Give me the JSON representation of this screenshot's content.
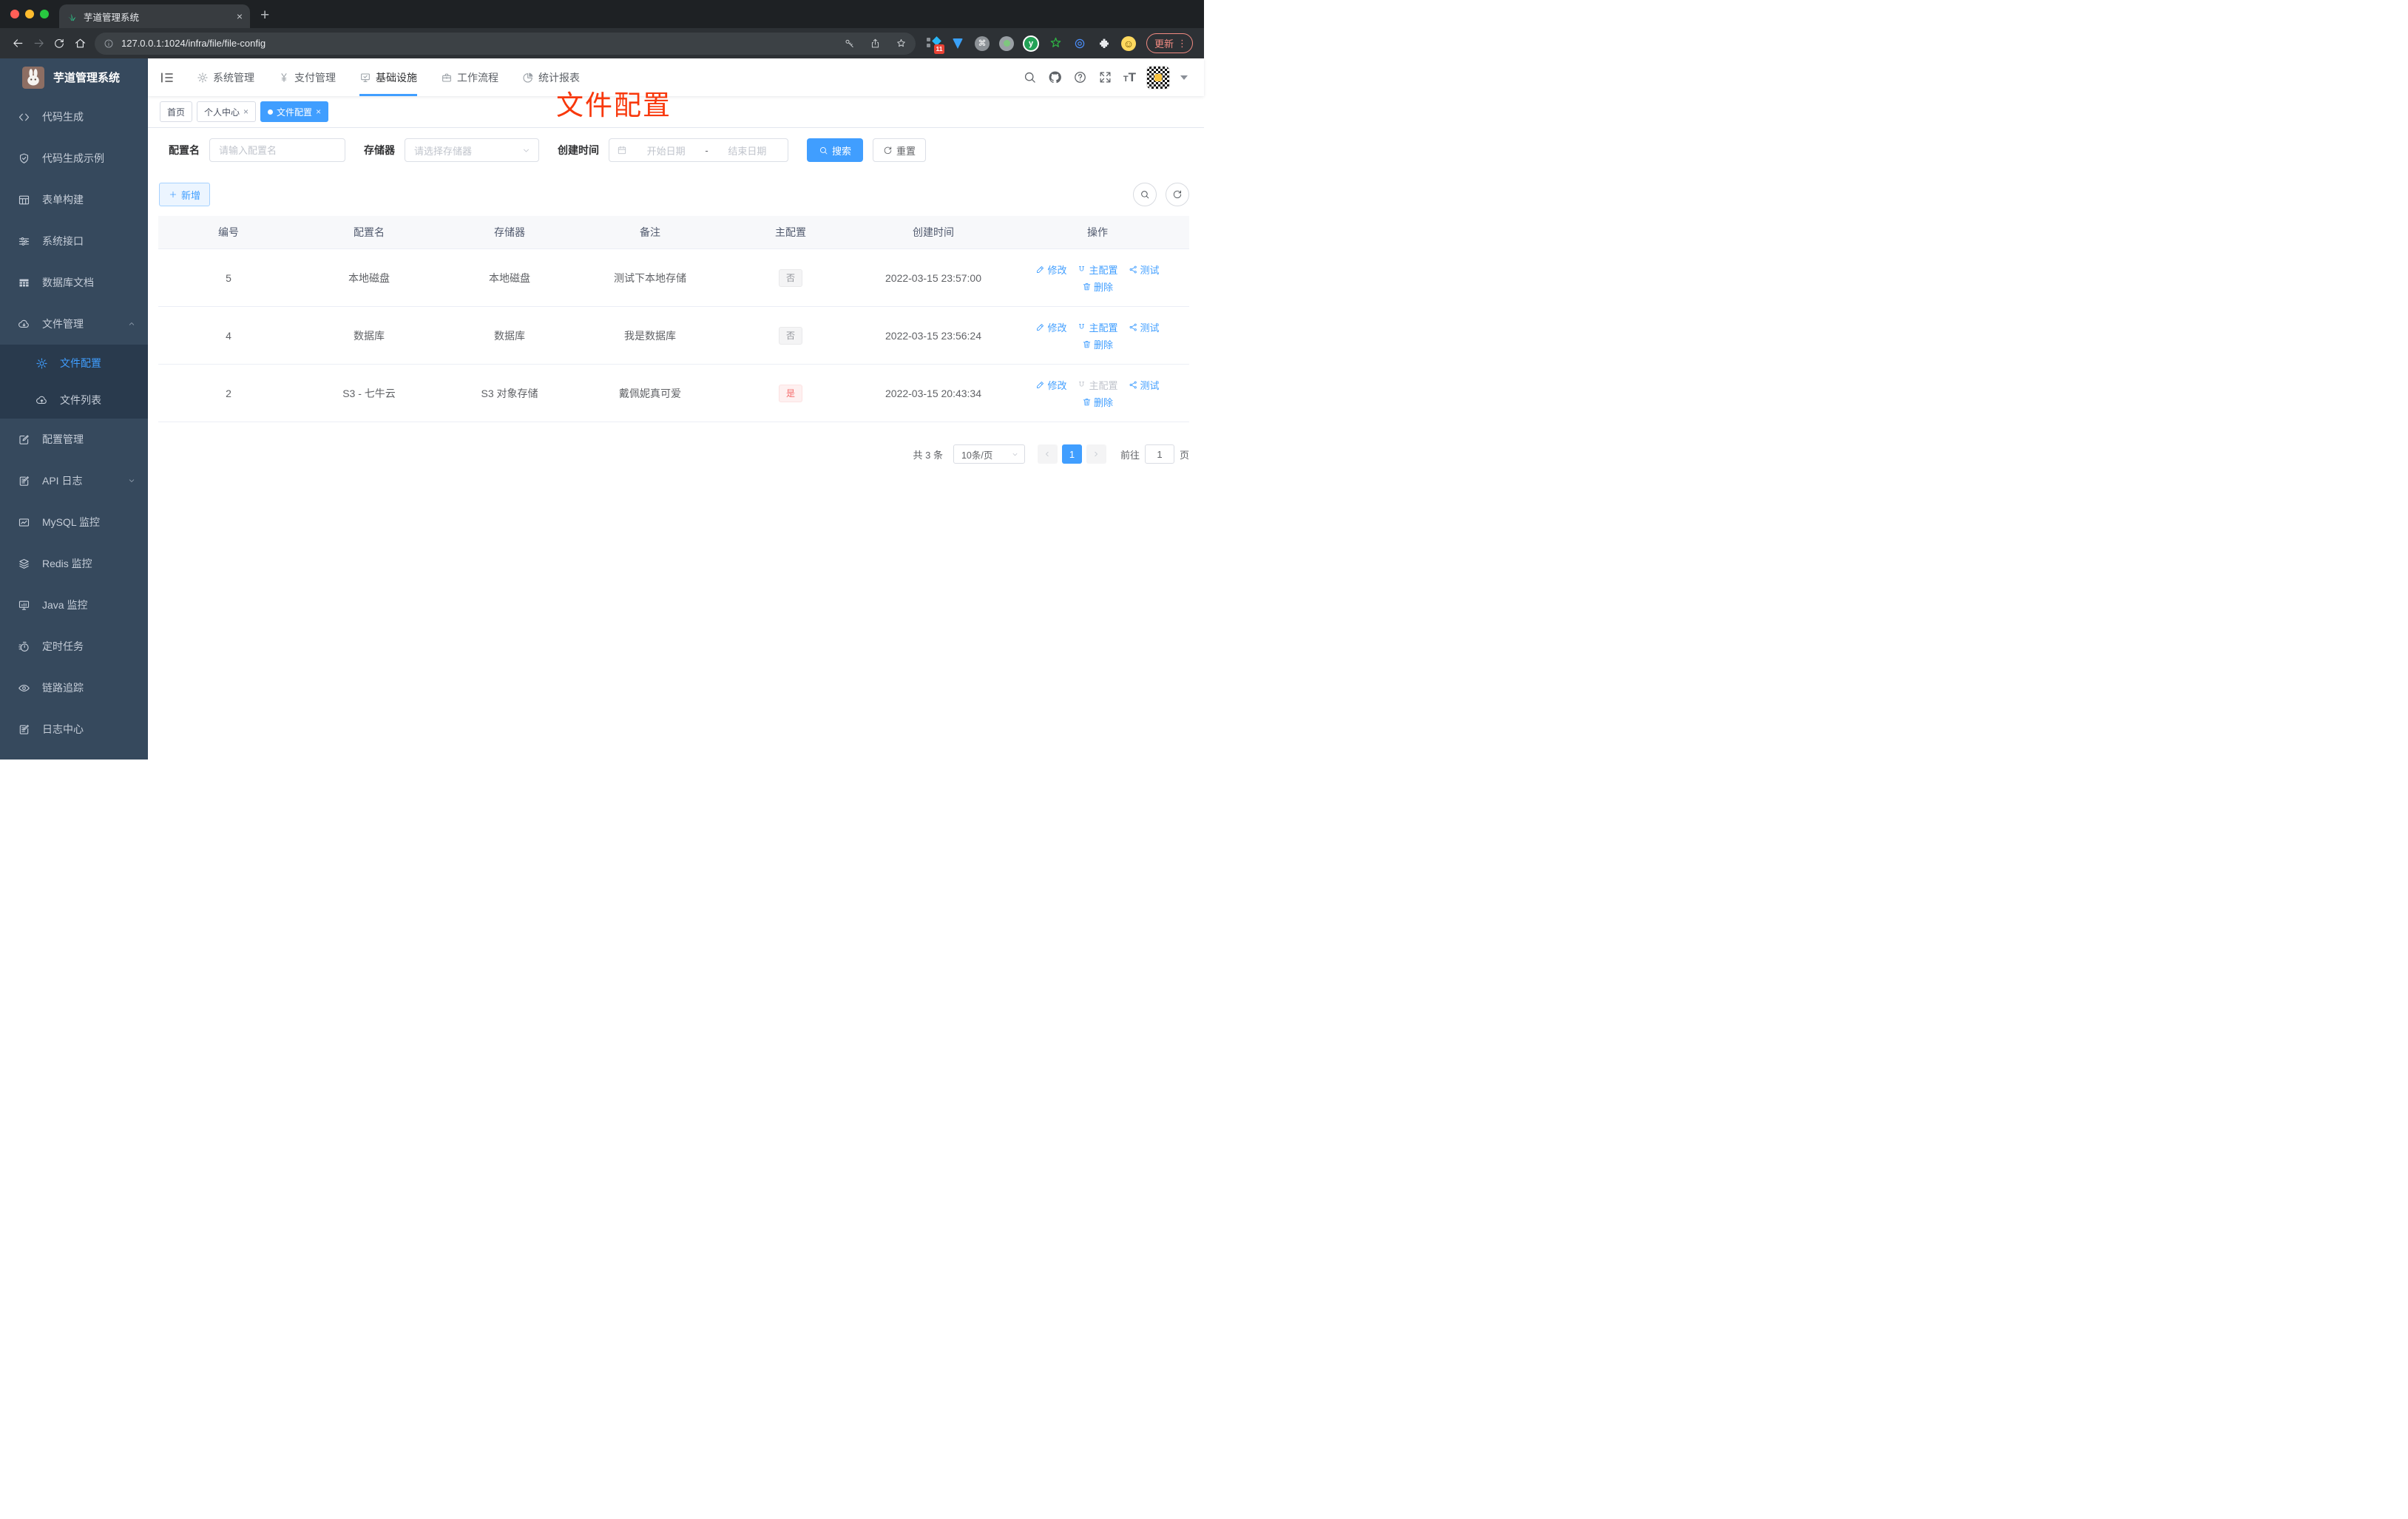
{
  "browser": {
    "tab_title": "芋道管理系统",
    "tab_close": "×",
    "new_tab": "+",
    "url": "127.0.0.1:1024/infra/file/file-config",
    "update_label": "更新",
    "menu_dots": "⋮",
    "extension_badge": "11",
    "cmd_glyph": "⌘",
    "smiley_glyph": "☺",
    "y_glyph": "y"
  },
  "sidebar": {
    "logo_title": "芋道管理系统",
    "items": [
      {
        "label": "代码生成"
      },
      {
        "label": "代码生成示例"
      },
      {
        "label": "表单构建"
      },
      {
        "label": "系统接口"
      },
      {
        "label": "数据库文档"
      },
      {
        "label": "文件管理"
      }
    ],
    "submenu": [
      {
        "label": "文件配置"
      },
      {
        "label": "文件列表"
      }
    ],
    "items_lower": [
      {
        "label": "配置管理"
      },
      {
        "label": "API 日志"
      },
      {
        "label": "MySQL 监控"
      },
      {
        "label": "Redis 监控"
      },
      {
        "label": "Java 监控"
      },
      {
        "label": "定时任务"
      },
      {
        "label": "链路追踪"
      },
      {
        "label": "日志中心"
      }
    ]
  },
  "topnav": {
    "items": [
      {
        "label": "系统管理"
      },
      {
        "label": "支付管理"
      },
      {
        "label": "基础设施"
      },
      {
        "label": "工作流程"
      },
      {
        "label": "统计报表"
      }
    ],
    "fontsize_small": "T",
    "fontsize_big": "T"
  },
  "tags": {
    "items": [
      {
        "label": "首页"
      },
      {
        "label": "个人中心"
      },
      {
        "label": "文件配置"
      }
    ],
    "close": "×"
  },
  "annotation": {
    "text": "文件配置",
    "color": "#f8380c"
  },
  "filters": {
    "name_label": "配置名",
    "name_placeholder": "请输入配置名",
    "storage_label": "存储器",
    "storage_placeholder": "请选择存储器",
    "date_label": "创建时间",
    "date_start": "开始日期",
    "date_separator": "-",
    "date_end": "结束日期",
    "search_label": "搜索",
    "reset_label": "重置"
  },
  "toolbar": {
    "add_label": "新增"
  },
  "table": {
    "headers": [
      "编号",
      "配置名",
      "存储器",
      "备注",
      "主配置",
      "创建时间",
      "操作"
    ],
    "actions": {
      "edit": "修改",
      "master": "主配置",
      "test": "测试",
      "remove": "删除"
    },
    "rows": [
      {
        "id": "5",
        "name": "本地磁盘",
        "storage": "本地磁盘",
        "remark": "测试下本地存储",
        "master": "否",
        "created": "2022-03-15 23:57:00"
      },
      {
        "id": "4",
        "name": "数据库",
        "storage": "数据库",
        "remark": "我是数据库",
        "master": "否",
        "created": "2022-03-15 23:56:24"
      },
      {
        "id": "2",
        "name": "S3 - 七牛云",
        "storage": "S3 对象存储",
        "remark": "戴佩妮真可爱",
        "master": "是",
        "created": "2022-03-15 20:43:34"
      }
    ]
  },
  "pagination": {
    "total": "共 3 条",
    "page_size": "10条/页",
    "page": "1",
    "goto_label": "前往",
    "goto_value": "1",
    "unit": "页"
  },
  "colors": {
    "accent": "#409eff",
    "danger_tag": "#f56c6c",
    "sidebar_bg": "#36495d"
  }
}
